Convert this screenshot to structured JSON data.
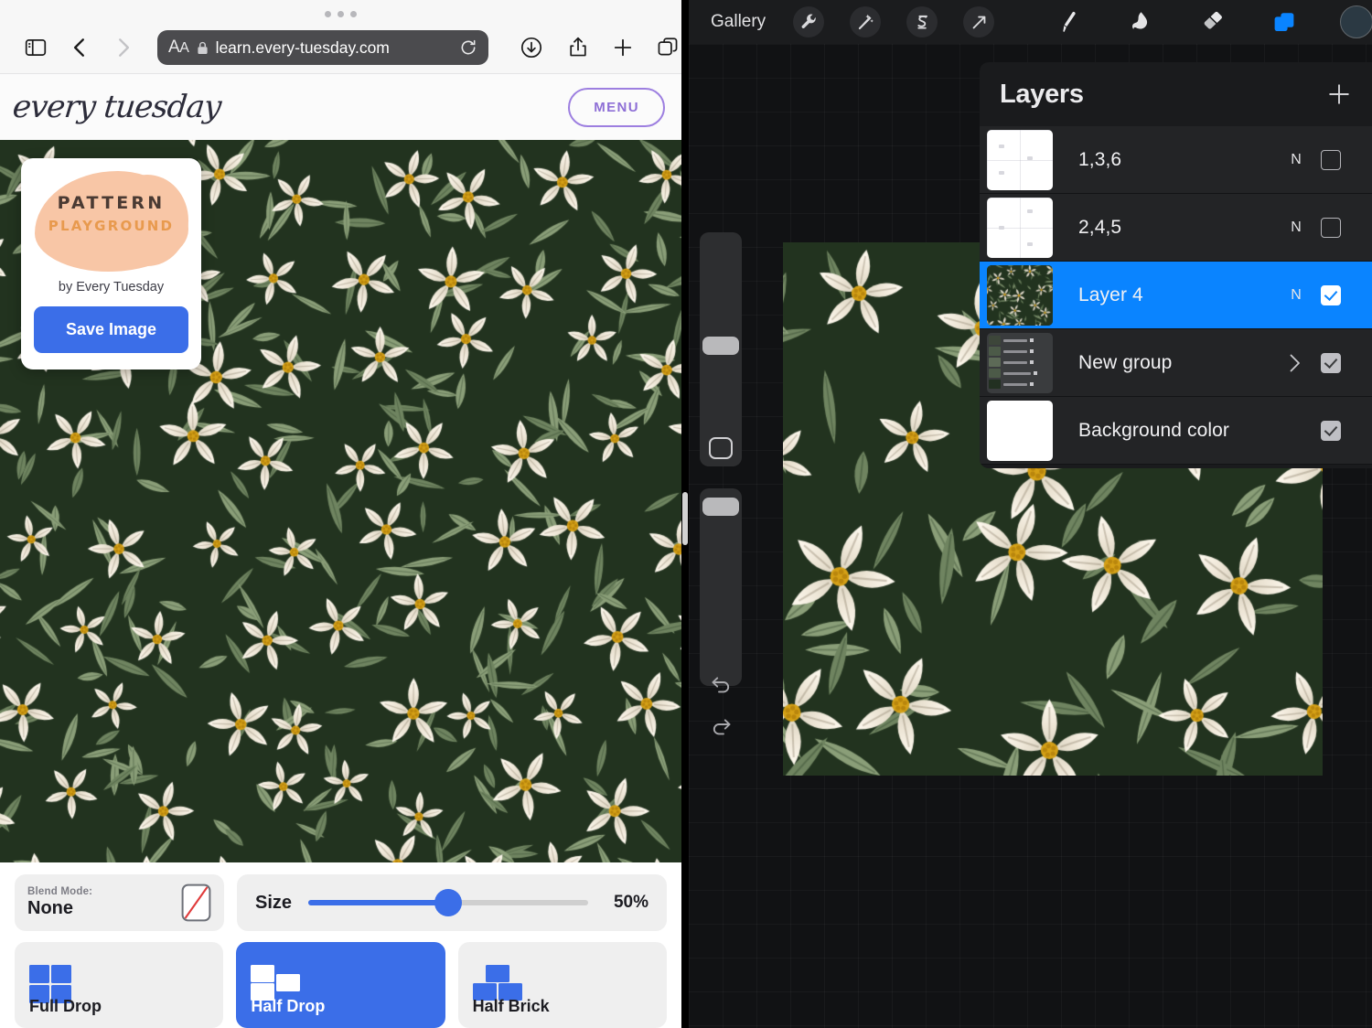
{
  "safari": {
    "toolbar": {
      "aa_label": "AA",
      "url": "learn.every-tuesday.com",
      "sidebar_icon": "sidebar-icon",
      "back_icon": "chevron-left-icon",
      "forward_icon": "chevron-right-icon",
      "lock_icon": "lock-icon",
      "reload_icon": "reload-icon",
      "download_icon": "download-icon",
      "share_icon": "share-icon",
      "newtab_icon": "plus-icon",
      "tabs_icon": "tabs-icon"
    },
    "site": {
      "logo_text": "every tuesday",
      "menu_label": "MENU"
    }
  },
  "save_card": {
    "logo_line1": "PATTERN",
    "logo_line2": "PLAYGROUND",
    "byline": "by Every Tuesday",
    "save_label": "Save Image"
  },
  "controls": {
    "blend_mode_label": "Blend Mode:",
    "blend_mode_value": "None",
    "blend_mode_icon": "no-blend-icon",
    "size_label": "Size",
    "size_value": "50%",
    "size_percent": 50,
    "layouts": [
      {
        "label": "Full Drop",
        "icon": "full-drop-icon",
        "selected": false
      },
      {
        "label": "Half Drop",
        "icon": "half-drop-icon",
        "selected": true
      },
      {
        "label": "Half Brick",
        "icon": "half-brick-icon",
        "selected": false
      }
    ]
  },
  "procreate": {
    "toolbar": {
      "gallery_label": "Gallery",
      "tools": [
        {
          "name": "actions-wrench-icon"
        },
        {
          "name": "adjustments-wand-icon"
        },
        {
          "name": "selection-s-icon"
        },
        {
          "name": "transform-arrow-icon"
        },
        {
          "name": "paint-brush-icon"
        },
        {
          "name": "smudge-icon"
        },
        {
          "name": "eraser-icon"
        },
        {
          "name": "layers-icon"
        },
        {
          "name": "color-swatch-icon"
        }
      ]
    },
    "sidebar": {
      "brush_size_icon": "brush-size-slider",
      "modify_icon": "modify-square-icon",
      "brush_opacity_icon": "brush-opacity-slider",
      "undo_icon": "undo-icon",
      "redo_icon": "redo-icon"
    },
    "layers": {
      "title": "Layers",
      "add_icon": "plus-icon",
      "items": [
        {
          "name": "1,3,6",
          "blend": "N",
          "checked": false,
          "thumb": "white-grid",
          "has_chevron": false
        },
        {
          "name": "2,4,5",
          "blend": "N",
          "checked": false,
          "thumb": "white-grid",
          "has_chevron": false
        },
        {
          "name": "Layer 4",
          "blend": "N",
          "checked": true,
          "thumb": "floral",
          "has_chevron": false,
          "selected": true
        },
        {
          "name": "New group",
          "blend": "",
          "checked": true,
          "thumb": "group-list",
          "has_chevron": true
        },
        {
          "name": "Background color",
          "blend": "",
          "checked": true,
          "thumb": "white",
          "has_chevron": false
        }
      ]
    }
  },
  "palette": {
    "pattern_bg": "#22331f",
    "petal": "#ece4d4",
    "petal_shadow": "#d9d2c0",
    "leaf": "#8a9e78",
    "leaf_dark": "#6f8460",
    "flower_center": "#d4a017",
    "accent_blue": "#3b6ee8",
    "procreate_blue": "#0a84ff",
    "menu_purple": "#8e6fd6",
    "blob_peach": "#f8c6a6"
  }
}
